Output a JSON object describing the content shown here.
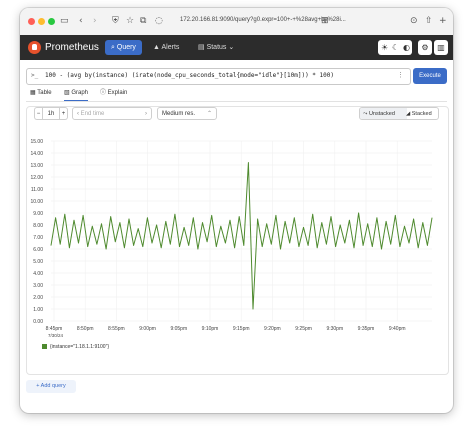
{
  "browser": {
    "url": "172.20.166.81:9090/query?g0.expr=100+-+%28avg+by%28i..."
  },
  "navbar": {
    "brand": "Prometheus",
    "query_label": "Query",
    "alerts_label": "Alerts",
    "status_label": "Status"
  },
  "query": {
    "prompt": ">_",
    "expression": "100 - (avg by(instance) (irate(node_cpu_seconds_total{mode=\"idle\"}[10m])) * 100)",
    "execute_label": "Execute"
  },
  "tabs": [
    {
      "label": "Table"
    },
    {
      "label": "Graph"
    },
    {
      "label": "Explain"
    }
  ],
  "controls": {
    "range": "1h",
    "end_time_placeholder": "End time",
    "resolution": "Medium res.",
    "unstacked": "Unstacked",
    "stacked": "Stacked"
  },
  "chart_data": {
    "type": "line",
    "ylim": [
      0,
      15
    ],
    "yticks": [
      "0.00",
      "1.00",
      "2.00",
      "3.00",
      "4.00",
      "5.00",
      "6.00",
      "7.00",
      "8.00",
      "9.00",
      "10.00",
      "11.00",
      "12.00",
      "13.00",
      "14.00",
      "15.00"
    ],
    "xticks": [
      "8:45pm",
      "8:50pm",
      "8:55pm",
      "9:00pm",
      "9:05pm",
      "9:10pm",
      "9:15pm",
      "9:20pm",
      "9:25pm",
      "9:30pm",
      "9:35pm",
      "9:40pm"
    ],
    "xtick_sub": "7/30/24",
    "grid": true,
    "legend_position": "bottom-left",
    "series": [
      {
        "name": "{instance=\"1.18.1.1:9100\"}",
        "color": "#4e8a2e",
        "values": [
          6.3,
          8.6,
          6.4,
          8.9,
          6.1,
          8.4,
          6.5,
          8.8,
          6.2,
          7.9,
          6.4,
          8.1,
          6.0,
          8.7,
          6.6,
          8.2,
          6.1,
          8.5,
          6.3,
          7.7,
          6.2,
          8.6,
          6.5,
          8.0,
          6.1,
          8.3,
          6.4,
          8.9,
          6.2,
          7.8,
          6.3,
          8.6,
          6.0,
          8.2,
          6.6,
          8.8,
          6.2,
          7.9,
          6.5,
          8.4,
          6.1,
          8.7,
          6.3,
          13.2,
          1.0,
          8.5,
          6.2,
          8.1,
          6.4,
          8.8,
          6.0,
          8.3,
          6.5,
          8.6,
          6.2,
          7.8,
          6.3,
          8.9,
          6.1,
          8.2,
          6.4,
          8.7,
          6.2,
          8.0,
          6.5,
          8.4,
          6.1,
          9.0,
          6.3,
          8.1,
          6.2,
          8.6,
          6.0,
          8.3,
          6.4,
          8.8,
          6.2,
          7.9,
          6.5,
          8.5,
          6.1,
          8.2,
          6.3,
          8.6
        ]
      }
    ]
  },
  "add_query_label": "+ Add query"
}
